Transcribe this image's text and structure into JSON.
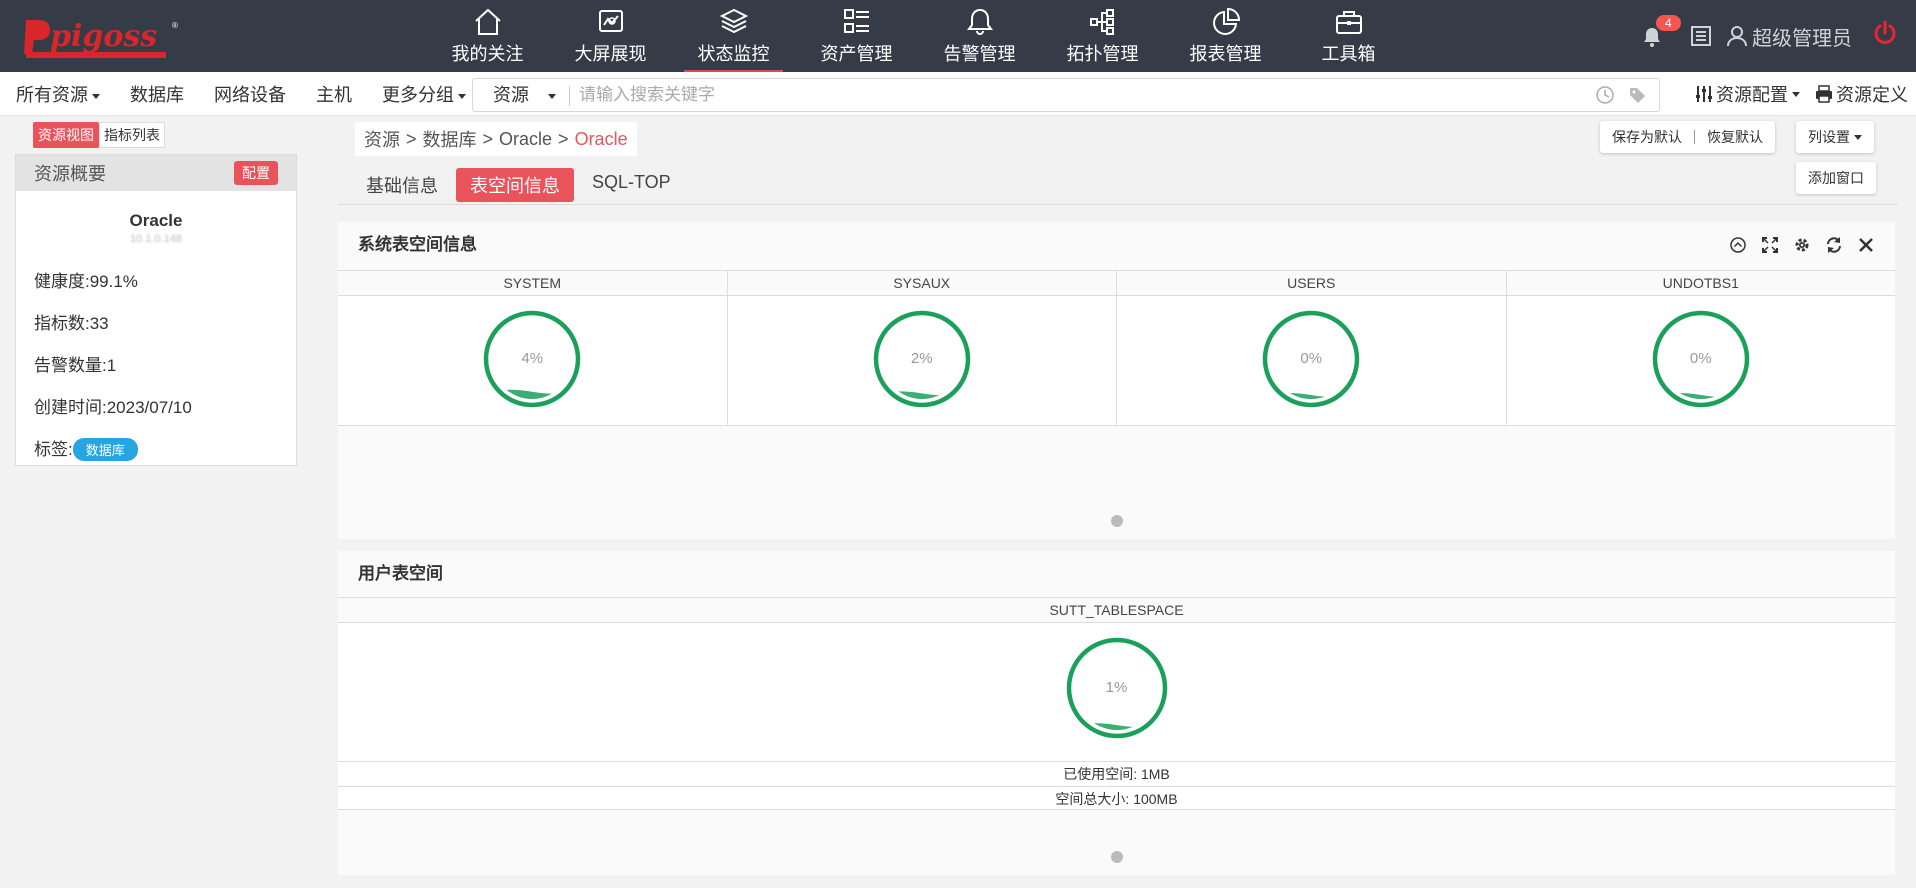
{
  "header": {
    "logo_text": "pigoss",
    "nav": [
      {
        "label": "我的关注",
        "icon": "home-icon"
      },
      {
        "label": "大屏展现",
        "icon": "screen-icon"
      },
      {
        "label": "状态监控",
        "icon": "layers-icon"
      },
      {
        "label": "资产管理",
        "icon": "list-icon"
      },
      {
        "label": "告警管理",
        "icon": "bell-icon"
      },
      {
        "label": "拓扑管理",
        "icon": "topology-icon"
      },
      {
        "label": "报表管理",
        "icon": "pie-chart-icon"
      },
      {
        "label": "工具箱",
        "icon": "toolbox-icon"
      }
    ],
    "active_nav": "状态监控",
    "notification_count": "4",
    "user_name": "超级管理员"
  },
  "menubar": {
    "items": [
      "所有资源",
      "数据库",
      "网络设备",
      "主机",
      "更多分组"
    ],
    "search_scope": "资源",
    "search_placeholder": "请输入搜索关键字",
    "resource_config": "资源配置",
    "resource_define": "资源定义"
  },
  "left_panel": {
    "view_resource": "资源视图",
    "view_metrics": "指标列表",
    "summary_title": "资源概要",
    "config_button": "配置",
    "resource_name": "Oracle",
    "resource_sub": "10.1.0.148",
    "health": "健康度:99.1%",
    "metrics": "指标数:33",
    "alerts": "告警数量:1",
    "created": "创建时间:2023/07/10",
    "tag_label": "标签:",
    "tag": "数据库"
  },
  "breadcrumb": [
    "资源",
    "数据库",
    "Oracle",
    "Oracle"
  ],
  "breadcrumb_sep": ">",
  "tabs": [
    "基础信息",
    "表空间信息",
    "SQL-TOP"
  ],
  "active_tab": "表空间信息",
  "actions": {
    "save_default": "保存为默认",
    "restore_default": "恢复默认",
    "column_settings": "列设置",
    "add_window": "添加窗口"
  },
  "system_panel": {
    "title": "系统表空间信息",
    "tablespaces": [
      {
        "name": "SYSTEM",
        "usage": "4%",
        "usage_value": 4
      },
      {
        "name": "SYSAUX",
        "usage": "2%",
        "usage_value": 2
      },
      {
        "name": "USERS",
        "usage": "0%",
        "usage_value": 0
      },
      {
        "name": "UNDOTBS1",
        "usage": "0%",
        "usage_value": 0
      }
    ]
  },
  "user_panel": {
    "title": "用户表空间",
    "tablespace": {
      "name": "SUTT_TABLESPACE",
      "usage": "1%",
      "usage_value": 1
    },
    "used_space": "已使用空间: 1MB",
    "total_space": "空间总大小: 100MB"
  },
  "colors": {
    "accent": "#e9545c",
    "topbar": "#353c47",
    "gauge": "#1aa05a",
    "tag": "#26a6e0"
  }
}
